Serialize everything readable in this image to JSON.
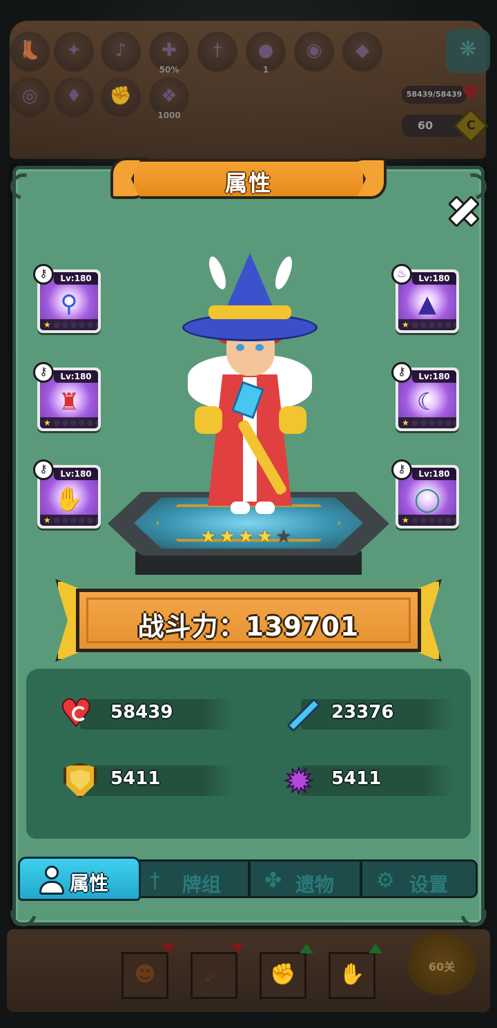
{
  "hud": {
    "slots_row1": [
      {
        "icon": "boot-icon",
        "count": ""
      },
      {
        "icon": "wing-icon",
        "count": ""
      },
      {
        "icon": "horn-icon",
        "count": ""
      },
      {
        "icon": "crossbow-icon",
        "count": "50%"
      },
      {
        "icon": "sword-icon",
        "count": ""
      },
      {
        "icon": "potion-icon",
        "count": "1"
      },
      {
        "icon": "coin-icon",
        "count": ""
      },
      {
        "icon": "rune-icon",
        "count": ""
      }
    ],
    "slots_row2": [
      {
        "icon": "target-icon",
        "count": ""
      },
      {
        "icon": "armor-icon",
        "count": ""
      },
      {
        "icon": "fist-icon",
        "count": ""
      },
      {
        "icon": "crystal-icon",
        "count": "1000"
      }
    ],
    "hp": "58439/58439",
    "coins": "60",
    "coin_symbol": "C"
  },
  "panel": {
    "title": "属性",
    "equipment": {
      "left": [
        {
          "level": "Lv:180",
          "item": "sapphire-wand-icon"
        },
        {
          "level": "Lv:180",
          "item": "red-robe-icon"
        },
        {
          "level": "Lv:180",
          "item": "jade-gauntlet-icon"
        }
      ],
      "right": [
        {
          "level": "Lv:180",
          "item": "wizard-hat-icon"
        },
        {
          "level": "Lv:180",
          "item": "moon-amulet-icon"
        },
        {
          "level": "Lv:180",
          "item": "emerald-ring-icon"
        }
      ]
    },
    "hero_stars": 4,
    "hero_stars_max": 5,
    "power_text": "战斗力：139701",
    "stats": {
      "hp": "58439",
      "attack": "23376",
      "defense": "5411",
      "magic": "5411"
    }
  },
  "tabs": [
    {
      "label": "属性",
      "icon": "person-icon",
      "active": true
    },
    {
      "label": "牌组",
      "icon": "sword-icon",
      "active": false
    },
    {
      "label": "遗物",
      "icon": "clover-icon",
      "active": false
    },
    {
      "label": "设置",
      "icon": "gear-icon",
      "active": false
    }
  ],
  "bottom": {
    "stage_label": "60关"
  },
  "colors": {
    "panel": "#5a9a7a",
    "stats_bg": "#2f6a52",
    "banner": "#f4a233",
    "active_tab": "#3fd0ee"
  }
}
